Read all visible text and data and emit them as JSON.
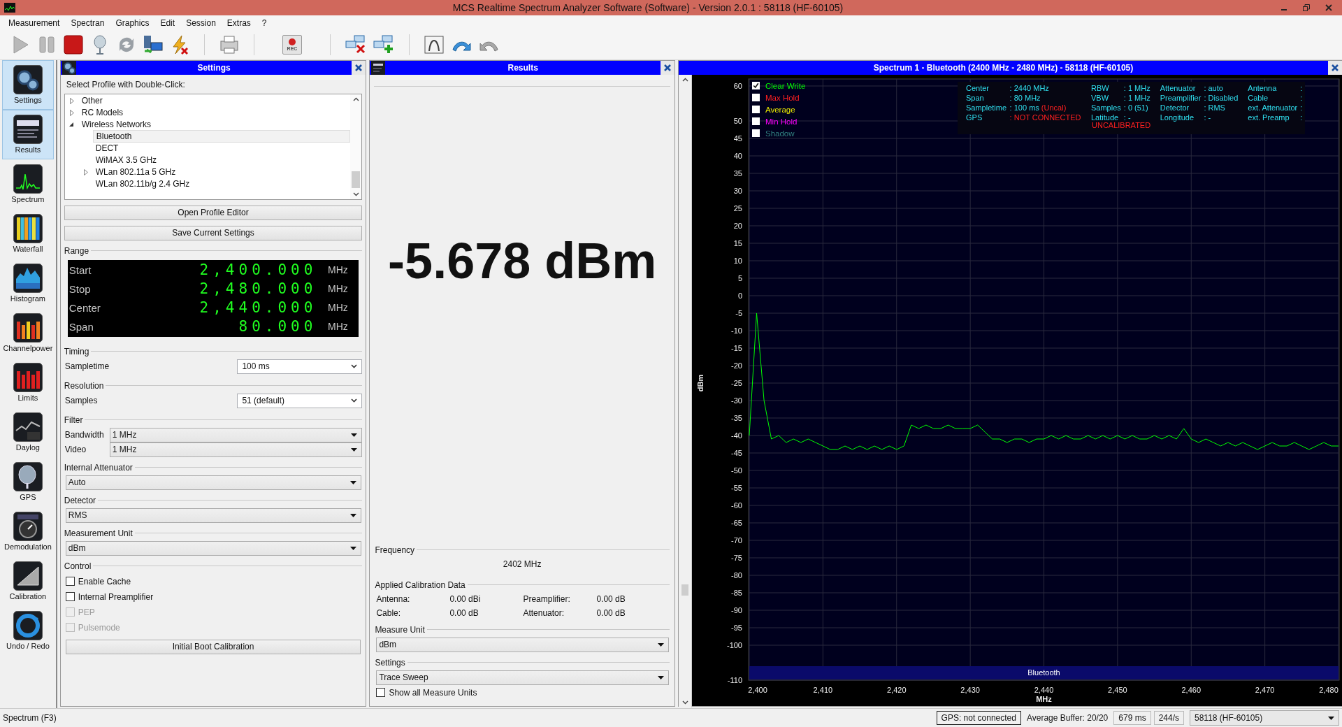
{
  "window": {
    "title": "MCS Realtime Spectrum Analyzer Software (Software) - Version 2.0.1 : 58118 (HF-60105)"
  },
  "menu": [
    "Measurement",
    "Spectran",
    "Graphics",
    "Edit",
    "Session",
    "Extras",
    "?"
  ],
  "toolbar": {
    "rec_label": "REC"
  },
  "sidebar": {
    "items": [
      {
        "label": "Settings",
        "selected": true
      },
      {
        "label": "Results",
        "selected": true
      },
      {
        "label": "Spectrum",
        "selected": false
      },
      {
        "label": "Waterfall",
        "selected": false
      },
      {
        "label": "Histogram",
        "selected": false
      },
      {
        "label": "Channelpower",
        "selected": false
      },
      {
        "label": "Limits",
        "selected": false
      },
      {
        "label": "Daylog",
        "selected": false
      },
      {
        "label": "GPS",
        "selected": false
      },
      {
        "label": "Demodulation",
        "selected": false
      },
      {
        "label": "Calibration",
        "selected": false
      },
      {
        "label": "Undo / Redo",
        "selected": false
      }
    ]
  },
  "settings": {
    "title": "Settings",
    "profile_prompt": "Select Profile with Double-Click:",
    "profiles": [
      {
        "label": "Other",
        "kind": "folder",
        "expanded": false,
        "selected": false
      },
      {
        "label": "RC Models",
        "kind": "folder",
        "expanded": false,
        "selected": false
      },
      {
        "label": "Wireless Networks",
        "kind": "folder",
        "expanded": true,
        "selected": false,
        "children": [
          {
            "label": "Bluetooth",
            "kind": "leaf",
            "selected": true
          },
          {
            "label": "DECT",
            "kind": "leaf",
            "selected": false
          },
          {
            "label": "WiMAX 3.5 GHz",
            "kind": "leaf",
            "selected": false
          },
          {
            "label": "WLan 802.11a 5 GHz",
            "kind": "folder",
            "expanded": false,
            "selected": false
          },
          {
            "label": "WLan 802.11b/g 2.4 GHz",
            "kind": "leaf",
            "selected": false
          }
        ]
      }
    ],
    "buttons": [
      "Open Profile Editor",
      "Save Current Settings"
    ],
    "range": {
      "label": "Range",
      "rows": [
        {
          "label": "Start",
          "value": "2,400.000",
          "unit": "MHz"
        },
        {
          "label": "Stop",
          "value": "2,480.000",
          "unit": "MHz"
        },
        {
          "label": "Center",
          "value": "2,440.000",
          "unit": "MHz"
        },
        {
          "label": "Span",
          "value": "80.000",
          "unit": "MHz"
        }
      ]
    },
    "sections": [
      {
        "label": "Timing",
        "kind": "fields",
        "fields": [
          {
            "label": "Sampletime",
            "value": "100 ms",
            "kind": "combo"
          }
        ]
      },
      {
        "label": "Resolution",
        "kind": "fields",
        "fields": [
          {
            "label": "Samples",
            "value": "51 (default)",
            "kind": "combo"
          }
        ]
      },
      {
        "label": "Filter",
        "kind": "fields",
        "fields": [
          {
            "label": "Bandwidth",
            "value": "1 MHz",
            "kind": "dropdown"
          },
          {
            "label": "Video",
            "value": "1 MHz",
            "kind": "dropdown"
          }
        ]
      },
      {
        "label": "Internal Attenuator",
        "kind": "select",
        "value": "Auto"
      },
      {
        "label": "Detector",
        "kind": "select",
        "value": "RMS"
      },
      {
        "label": "Measurement Unit",
        "kind": "select",
        "value": "dBm"
      },
      {
        "label": "Control",
        "kind": "checks",
        "options": [
          {
            "label": "Enable Cache",
            "checked": false,
            "disabled": false
          },
          {
            "label": "Internal Preamplifier",
            "checked": false,
            "disabled": false
          },
          {
            "label": "PEP",
            "checked": false,
            "disabled": true
          },
          {
            "label": "Pulsemode",
            "checked": false,
            "disabled": true
          }
        ]
      }
    ],
    "calibration_button": "Initial Boot Calibration"
  },
  "results": {
    "title": "Results",
    "reading": "-5.678 dBm",
    "frequency": {
      "label": "Frequency",
      "value": "2402 MHz"
    },
    "calibration": {
      "label": "Applied Calibration Data",
      "items": [
        {
          "label": "Antenna:",
          "value": "0.00 dBi"
        },
        {
          "label": "Preamplifier:",
          "value": "0.00 dB"
        },
        {
          "label": "Cable:",
          "value": "0.00 dB"
        },
        {
          "label": "Attenuator:",
          "value": "0.00 dB"
        }
      ]
    },
    "measure_unit": {
      "label": "Measure Unit",
      "value": "dBm"
    },
    "mode": {
      "label": "Settings",
      "value": "Trace Sweep"
    },
    "show_all_units": {
      "label": "Show all Measure Units",
      "checked": false
    }
  },
  "spectrum": {
    "title": "Spectrum 1 - Bluetooth (2400 MHz - 2480 MHz) - 58118 (HF-60105)",
    "traces": [
      {
        "label": "Clear Write",
        "checked": true,
        "color": "#00ff00"
      },
      {
        "label": "Max Hold",
        "checked": false,
        "color": "#ff2020"
      },
      {
        "label": "Average",
        "checked": false,
        "color": "#e8e800"
      },
      {
        "label": "Min Hold",
        "checked": false,
        "color": "#ff00ff"
      },
      {
        "label": "Shadow",
        "checked": false,
        "color": "#308080"
      }
    ],
    "info_columns": [
      [
        {
          "label": "Center",
          "value": ": 2440 MHz",
          "alert": false
        },
        {
          "label": "Span",
          "value": ": 80 MHz",
          "alert": false
        },
        {
          "label": "Sampletime",
          "value": ": 100 ms",
          "note": "(Uncal)",
          "alert": false
        },
        {
          "label": "GPS",
          "value": ": NOT CONNECTED",
          "alert": true
        }
      ],
      [
        {
          "label": "RBW",
          "value": ": 1 MHz",
          "alert": false
        },
        {
          "label": "VBW",
          "value": ": 1 MHz",
          "alert": false
        },
        {
          "label": "Samples",
          "value": ": 0 (51)",
          "alert": false
        },
        {
          "label": "Latitude",
          "value": ": -",
          "alert": false
        }
      ],
      [
        {
          "label": "Attenuator",
          "value": ": auto",
          "alert": false
        },
        {
          "label": "Preamplifier",
          "value": ": Disabled",
          "alert": false
        },
        {
          "label": "Detector",
          "value": ": RMS",
          "alert": false
        },
        {
          "label": "Longitude",
          "value": ": -",
          "alert": false
        }
      ],
      [
        {
          "label": "Antenna",
          "value": ":",
          "alert": false
        },
        {
          "label": "Cable",
          "value": ":",
          "alert": false
        },
        {
          "label": "ext. Attenuator",
          "value": ":",
          "alert": false
        },
        {
          "label": "ext. Preamp",
          "value": ":",
          "alert": false
        }
      ]
    ],
    "warning": "UNCALIBRATED",
    "band": {
      "label": "Bluetooth"
    },
    "chart_data": {
      "type": "line",
      "xlabel": "MHz",
      "ylabel": "dBm",
      "xlim": [
        2400,
        2480
      ],
      "ylim": [
        -110,
        60
      ],
      "grid": true,
      "x": [
        2400,
        2401,
        2402,
        2403,
        2404,
        2405,
        2406,
        2407,
        2408,
        2409,
        2410,
        2411,
        2412,
        2413,
        2414,
        2415,
        2416,
        2417,
        2418,
        2419,
        2420,
        2421,
        2422,
        2423,
        2424,
        2425,
        2426,
        2427,
        2428,
        2429,
        2430,
        2431,
        2432,
        2433,
        2434,
        2435,
        2436,
        2437,
        2438,
        2439,
        2440,
        2441,
        2442,
        2443,
        2444,
        2445,
        2446,
        2447,
        2448,
        2449,
        2450,
        2451,
        2452,
        2453,
        2454,
        2455,
        2456,
        2457,
        2458,
        2459,
        2460,
        2461,
        2462,
        2463,
        2464,
        2465,
        2466,
        2467,
        2468,
        2469,
        2470,
        2471,
        2472,
        2473,
        2474,
        2475,
        2476,
        2477,
        2478,
        2479,
        2480
      ],
      "series": [
        {
          "color": "#00ff00",
          "values": [
            -40,
            -5,
            -30,
            -41,
            -40,
            -42,
            -41,
            -42,
            -41,
            -42,
            -43,
            -44,
            -44,
            -43,
            -44,
            -43,
            -44,
            -43,
            -44,
            -43,
            -44,
            -43,
            -37,
            -38,
            -37,
            -38,
            -38,
            -37,
            -38,
            -38,
            -38,
            -37,
            -39,
            -41,
            -41,
            -42,
            -41,
            -41,
            -42,
            -41,
            -41,
            -40,
            -41,
            -40,
            -41,
            -41,
            -40,
            -41,
            -40,
            -41,
            -40,
            -41,
            -40,
            -41,
            -41,
            -40,
            -41,
            -40,
            -41,
            -38,
            -41,
            -42,
            -41,
            -42,
            -43,
            -42,
            -43,
            -42,
            -43,
            -44,
            -43,
            -42,
            -43,
            -43,
            -42,
            -43,
            -44,
            -43,
            -42,
            -43,
            -43
          ]
        }
      ],
      "xticks": [
        {
          "value": 2400,
          "label": "2,400"
        },
        {
          "value": 2410,
          "label": "2,410"
        },
        {
          "value": 2420,
          "label": "2,420"
        },
        {
          "value": 2430,
          "label": "2,430"
        },
        {
          "value": 2440,
          "label": "2,440"
        },
        {
          "value": 2450,
          "label": "2,450"
        },
        {
          "value": 2460,
          "label": "2,460"
        },
        {
          "value": 2470,
          "label": "2,470"
        },
        {
          "value": 2480,
          "label": "2,480"
        }
      ],
      "yticks": [
        60,
        50,
        45,
        40,
        35,
        30,
        25,
        20,
        15,
        10,
        5,
        0,
        -5,
        -10,
        -15,
        -20,
        -25,
        -30,
        -35,
        -40,
        -45,
        -50,
        -55,
        -60,
        -65,
        -70,
        -75,
        -80,
        -85,
        -90,
        -95,
        -100,
        -110
      ]
    }
  },
  "status_bar": {
    "mode": "Spectrum (F3)",
    "gps": "GPS: not connected",
    "buffer": "Average Buffer: 20/20",
    "latency": "679 ms",
    "rate": "244/s",
    "device": "58118 (HF-60105)"
  }
}
